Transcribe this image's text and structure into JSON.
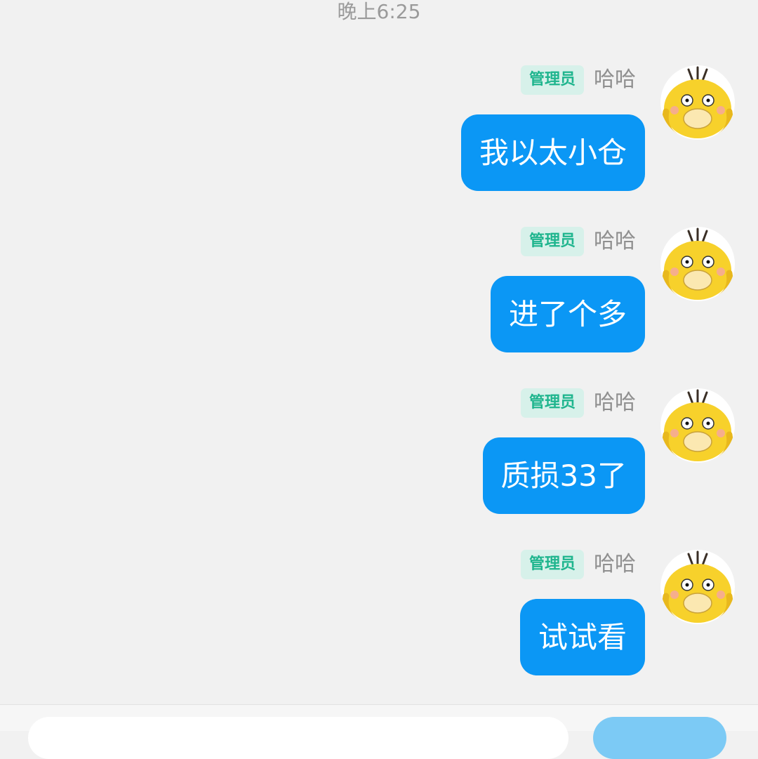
{
  "timestamp": "晚上6:25",
  "colors": {
    "background": "#f1f1f1",
    "bubble": "#0b97f5",
    "badge_bg": "#d7f1ea",
    "badge_text": "#1fb58e",
    "send_button": "#7ccaf5"
  },
  "messages": [
    {
      "role_badge": "管理员",
      "sender": "哈哈",
      "text": "我以太小仓",
      "avatar_icon": "psyduck-avatar-icon"
    },
    {
      "role_badge": "管理员",
      "sender": "哈哈",
      "text": "进了个多",
      "avatar_icon": "psyduck-avatar-icon"
    },
    {
      "role_badge": "管理员",
      "sender": "哈哈",
      "text": "质损33了",
      "avatar_icon": "psyduck-avatar-icon"
    },
    {
      "role_badge": "管理员",
      "sender": "哈哈",
      "text": "试试看",
      "avatar_icon": "psyduck-avatar-icon"
    }
  ]
}
